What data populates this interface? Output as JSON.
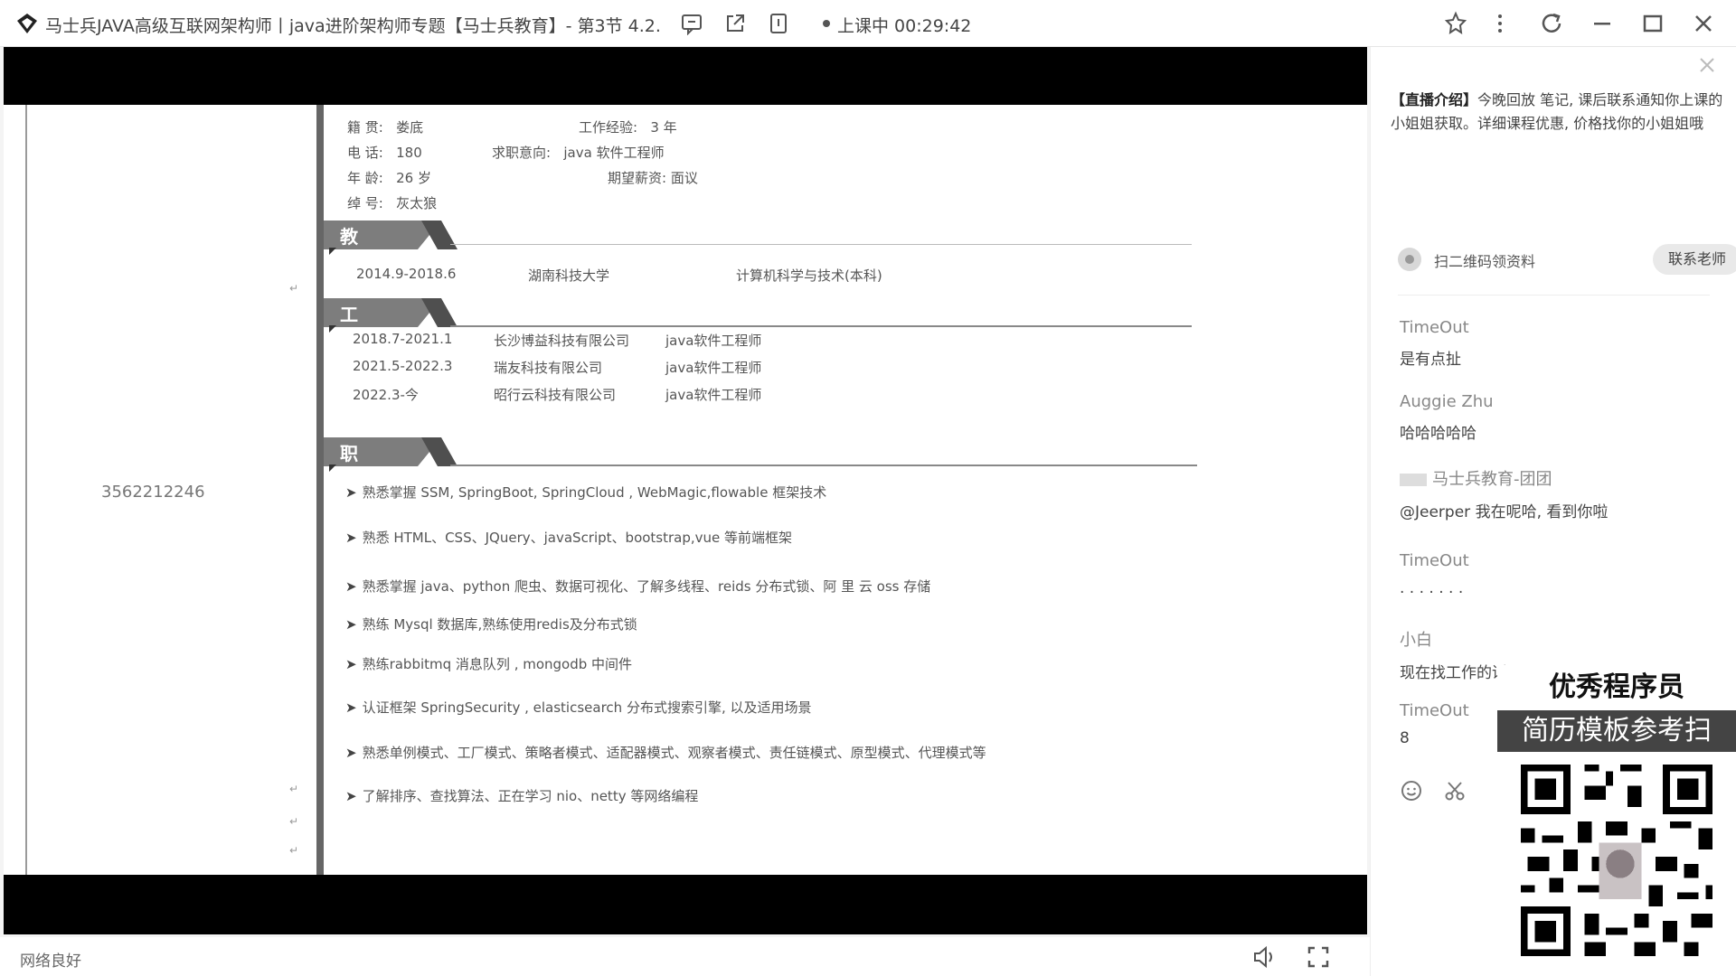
{
  "titlebar": {
    "title": "马士兵JAVA高级互联网架构师丨java进阶架构师专题【马士兵教育】- 第3节 4.2.",
    "live_status": "上课中 00:29:42"
  },
  "resume": {
    "info": [
      {
        "label": "籍 贯:",
        "value": "娄底"
      },
      {
        "label": "电 话:",
        "value": "180"
      },
      {
        "label": "年 龄:",
        "value": "26 岁"
      },
      {
        "label": "绰 号:",
        "value": "灰太狼"
      },
      {
        "label": "工作经验:",
        "value": "3 年"
      },
      {
        "label": "求职意向:",
        "value": "java 软件工程师"
      },
      {
        "label": "期望薪资:",
        "value": "面议"
      }
    ],
    "sections": {
      "education": "教育培训",
      "work": "工作经验",
      "skills": "职业技能"
    },
    "education": [
      {
        "period": "2014.9-2018.6",
        "school": "湖南科技大学",
        "major": "计算机科学与技术(本科)"
      }
    ],
    "work": [
      {
        "period": "2018.7-2021.1",
        "company": "长沙博益科技有限公司",
        "role": "java软件工程师"
      },
      {
        "period": "2021.5-2022.3",
        "company": "瑞友科技有限公司",
        "role": "java软件工程师"
      },
      {
        "period": "2022.3-今",
        "company": "昭行云科技有限公司",
        "role": "java软件工程师"
      }
    ],
    "skills": [
      "熟悉掌握 SSM, SpringBoot, SpringCloud , WebMagic,flowable 框架技术",
      "熟悉 HTML、CSS、JQuery、javaScript、bootstrap,vue 等前端框架",
      "熟悉掌握 java、python 爬虫、数据可视化、了解多线程、reids 分布式锁、阿 里 云 oss 存储",
      "熟练 Mysql 数据库,熟练使用redis及分布式锁",
      "熟练rabbitmq 消息队列 , mongodb 中间件",
      "认证框架 SpringSecurity , elasticsearch 分布式搜索引擎, 以及适用场景",
      "熟悉单例模式、工厂模式、策略者模式、适配器模式、观察者模式、责任链模式、原型模式、代理模式等",
      "了解排序、查找算法、正在学习 nio、netty 等网络编程"
    ],
    "left_number": "3562212246"
  },
  "statusbar": {
    "network": "网络良好"
  },
  "panel": {
    "intro_tag": "【直播介绍】",
    "intro_text": "今晚回放 笔记, 课后联系通知你上课的小姐姐获取。详细课程优惠, 价格找你的小姐姐哦",
    "qr_text": "扫二维码领资料",
    "contact_button": "联系老师",
    "chat": [
      {
        "name": "TimeOut",
        "msg": "是有点扯"
      },
      {
        "name": "Auggie Zhu",
        "msg": "哈哈哈哈哈"
      },
      {
        "name": "马士兵教育-团团",
        "msg": "@Jeerper 我在呢哈, 看到你啦"
      },
      {
        "name": "TimeOut",
        "msg": ". . . . . . ."
      },
      {
        "name": "小白",
        "msg": "现在找工作的话"
      },
      {
        "name": "TimeOut",
        "msg": "8"
      }
    ]
  },
  "ad": {
    "line1": "优秀程序员",
    "line2": "简历模板参考扫"
  }
}
